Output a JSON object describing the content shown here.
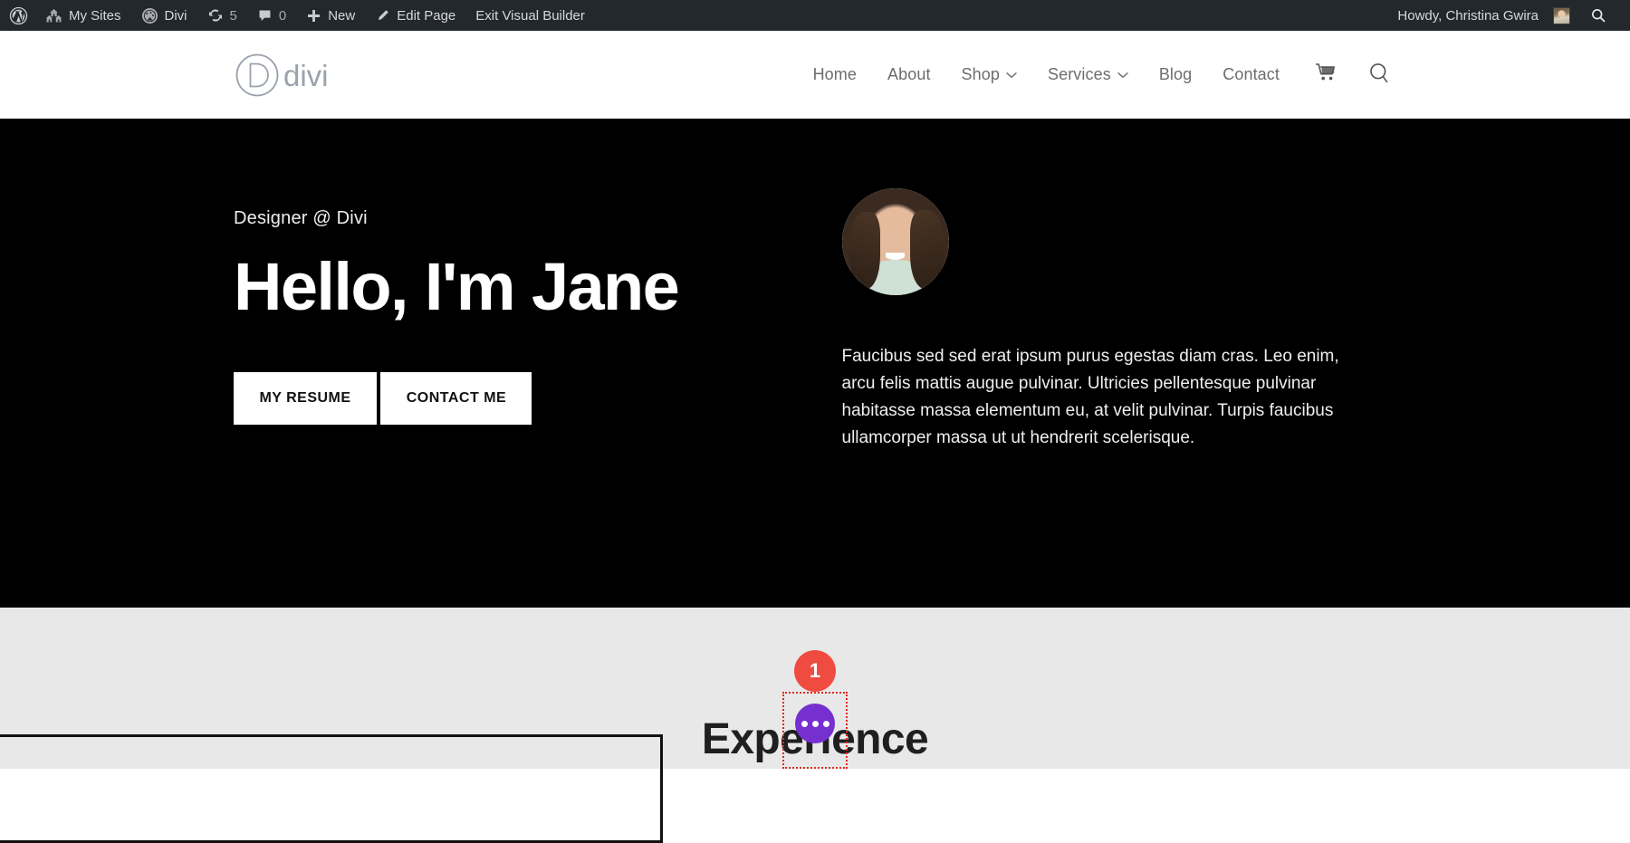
{
  "adminbar": {
    "items": [
      {
        "icon": "wordpress-logo-icon",
        "label": ""
      },
      {
        "icon": "my-sites-icon",
        "label": "My Sites"
      },
      {
        "icon": "divi-icon",
        "label": "Divi"
      },
      {
        "icon": "updates-icon",
        "label": "5"
      },
      {
        "icon": "comments-icon",
        "label": "0"
      },
      {
        "icon": "new-plus-icon",
        "label": "New"
      },
      {
        "icon": "edit-pencil-icon",
        "label": "Edit Page"
      },
      {
        "icon": "",
        "label": "Exit Visual Builder"
      }
    ],
    "my_sites": "My Sites",
    "divi": "Divi",
    "updates_count": "5",
    "comments_count": "0",
    "new": "New",
    "edit_page": "Edit Page",
    "exit_visual_builder": "Exit Visual Builder",
    "howdy": "Howdy, Christina Gwira",
    "bg_color": "#23282d"
  },
  "header": {
    "logo_text": "divi",
    "nav": [
      {
        "label": "Home",
        "has_dropdown": false
      },
      {
        "label": "About",
        "has_dropdown": false
      },
      {
        "label": "Shop",
        "has_dropdown": true
      },
      {
        "label": "Services",
        "has_dropdown": true
      },
      {
        "label": "Blog",
        "has_dropdown": false
      },
      {
        "label": "Contact",
        "has_dropdown": false
      }
    ],
    "cart_icon": "shopping-cart-icon",
    "search_icon": "search-icon"
  },
  "hero": {
    "kicker": "Designer @ Divi",
    "title": "Hello, I'm Jane",
    "button_primary": "MY RESUME",
    "button_secondary": "CONTACT ME",
    "paragraph": "Faucibus sed sed erat ipsum purus egestas diam cras. Leo enim, arcu felis mattis augue pulvinar. Ultricies pellentesque pulvinar habitasse massa elementum eu, at velit pulvinar. Turpis faucibus ullamcorper massa ut ut hendrerit scelerisque.",
    "bg_color": "#000000"
  },
  "section_experience": {
    "heading": "Experience",
    "bg_color": "#e8e8e8"
  },
  "visual_builder": {
    "badge_number": "1",
    "badge_color": "#f04b40",
    "settings_button_color": "#7630cf",
    "highlight_border_color": "#e02b20"
  }
}
